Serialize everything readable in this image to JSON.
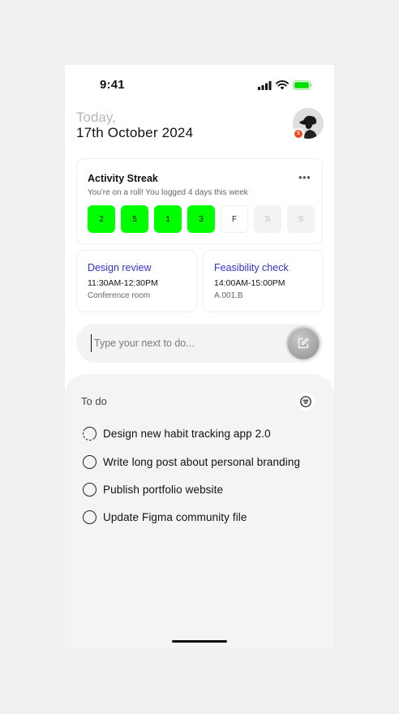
{
  "status_bar": {
    "time": "9:41"
  },
  "header": {
    "date_prefix": "Today,",
    "date": "17th October 2024",
    "avatar_badge": "5"
  },
  "streak": {
    "title": "Activity Streak",
    "subtitle": "You're on a roll! You logged 4 days this week",
    "days": [
      "2",
      "5",
      "1",
      "3",
      "F",
      "S",
      "S"
    ],
    "accent_color": "#00ff00"
  },
  "events": [
    {
      "title": "Design review",
      "time": "11:30AM-12:30PM",
      "place": "Conference room"
    },
    {
      "title": "Feasibility check",
      "time": "14:00AM-15:00PM",
      "place": "A.001.B"
    }
  ],
  "input": {
    "placeholder": "Type your next to do..."
  },
  "todo": {
    "title": "To do",
    "tasks": [
      {
        "label": "Design new habit tracking app 2.0",
        "state": "in-progress"
      },
      {
        "label": "Write long post about personal branding",
        "state": "open"
      },
      {
        "label": "Publish portfolio website",
        "state": "open"
      },
      {
        "label": "Update Figma community file",
        "state": "open"
      }
    ]
  },
  "icons": {
    "more": "more-horizontal-icon",
    "compose": "compose-icon",
    "filter": "filter-icon",
    "signal": "cellular-signal-icon",
    "wifi": "wifi-icon",
    "battery": "battery-icon"
  }
}
